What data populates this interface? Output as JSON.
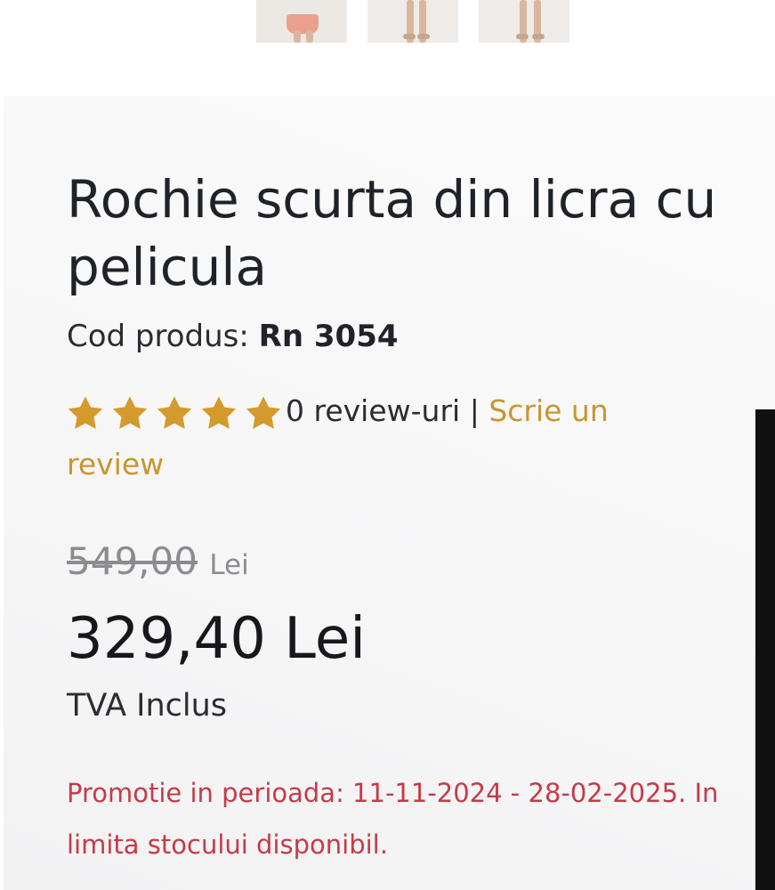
{
  "gallery": {
    "thumbnails": [
      "product-photo-1",
      "product-photo-2",
      "product-photo-3"
    ]
  },
  "product": {
    "title": "Rochie scurta din licra cu pelicula",
    "code_label": "Cod produs:",
    "code_value": "Rn 3054",
    "rating": {
      "stars": 5,
      "reviews_text": "0 review-uri",
      "separator": "|",
      "write_review_link": "Scrie un review",
      "star_color": "#d49a2b"
    },
    "old_price": "549,00",
    "old_price_currency": "Lei",
    "new_price": "329,40 Lei",
    "vat_text": "TVA Inclus",
    "promo_text": "Promotie in perioada: 11-11-2024 - 28-02-2025. In limita stocului disponibil."
  },
  "colors": {
    "accent_gold": "#c8962e",
    "promo_red": "#c63a48",
    "text_dark": "#1f2329"
  }
}
